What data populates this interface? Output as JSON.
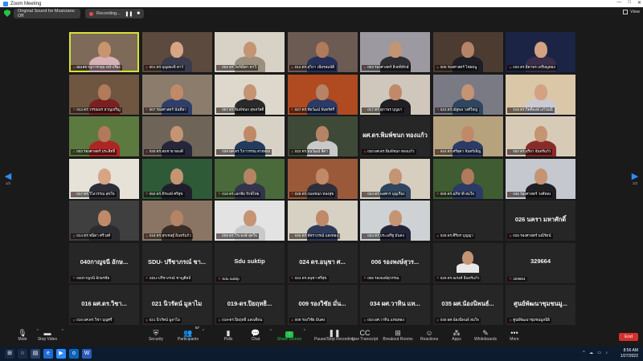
{
  "window": {
    "title": "Zoom Meeting",
    "controls": [
      "—",
      "□",
      "✕"
    ]
  },
  "topbar": {
    "sound_label": "Original Sound for Musicians: Off",
    "recording_label": "Recording...",
    "pause_glyph": "❚❚",
    "stop_glyph": "■",
    "view_label": "View"
  },
  "pager": {
    "left_page": "1/2",
    "right_page": "1/2"
  },
  "participants": [
    {
      "name": "ผมเลขานุการกลุ่ม หน้าเรียง",
      "kind": "video",
      "bg": "#7d6a58",
      "skin": "#c8946e",
      "shirt": "#d8b0b8",
      "active": true
    },
    {
      "name": "001 ดร.บุญผ่องจิ ตาว์",
      "kind": "video",
      "bg": "#5d4a3e",
      "skin": "#d7a586",
      "shirt": "#3b3b4e"
    },
    {
      "name": "002 ดร.ไพร์ณิดา ตาวี",
      "kind": "video",
      "bg": "#d8d1c6",
      "skin": "#c49473",
      "shirt": "#9b8f7d"
    },
    {
      "name": "012 ดร.สุวิภา เพียรสมบัติ",
      "kind": "video",
      "bg": "#6b5b52",
      "skin": "#b07a5b",
      "shirt": "#24305a"
    },
    {
      "name": "003 รองศาสตร์ สิงหพิทักษ์",
      "kind": "video",
      "bg": "#9c9aa0",
      "skin": "#c49473",
      "shirt": "#2d2d32"
    },
    {
      "name": "005 รองศาสตร์ ไชยธนู",
      "kind": "video",
      "bg": "#4c3b31",
      "skin": "#b58365",
      "shirt": "#1e1e26"
    },
    {
      "name": "020 ดร.ธิดาพร เหรียญทอง",
      "kind": "video",
      "bg": "#1b2444",
      "skin": "#d4a182",
      "shirt": "#3a2d4a"
    },
    {
      "name": "013 ดร.วรรณพร หาญเจริญ",
      "kind": "video",
      "bg": "#6e5640",
      "skin": "#b07a5b",
      "shirt": "#7a2020"
    },
    {
      "name": "007 รองศาสตร์ นันทิยา",
      "kind": "video",
      "bg": "#8b7c6c",
      "skin": "#c08a68",
      "shirt": "#2f3f6a"
    },
    {
      "name": "007 ดร.พิมพ์ชนก สุขสวัสดิ์",
      "kind": "video",
      "bg": "#ded8cc",
      "skin": "#c49473",
      "shirt": "#2a2a2a"
    },
    {
      "name": "027 ดร.ชัยวัฒน์ จันทร์ศรี",
      "kind": "video",
      "bg": "#b04a20",
      "skin": "#b58365",
      "shirt": "#2b3a66"
    },
    {
      "name": "017 ดร.สุภาพร บุญมา",
      "kind": "video",
      "bg": "#cfc7bb",
      "skin": "#c08a68",
      "shirt": "#1f1f24"
    },
    {
      "name": "023 ดร.ณัฐพล วงศ์ใหญ่",
      "kind": "video",
      "bg": "#7a7a84",
      "skin": "#c49473",
      "shirt": "#30455e"
    },
    {
      "name": "019 ดร.กิตติพงษ์ แก้วมณี",
      "kind": "video",
      "bg": "#d9c7a8",
      "skin": "#d4a182",
      "shirt": "#c9c9d2"
    },
    {
      "name": "003 รองศาสตร์ ประสิทธิ์",
      "kind": "video",
      "bg": "#5c7a3f",
      "skin": "#b07a5b",
      "shirt": "#b02424"
    },
    {
      "name": "030 ดร.สมชาย ทองดี",
      "kind": "video",
      "bg": "#6e6458",
      "skin": "#c49473",
      "shirt": "#26263a"
    },
    {
      "name": "039 ผศ.ดร.วิภาวรรณ สายทอง",
      "kind": "video",
      "bg": "#d8d2c6",
      "skin": "#c08a68",
      "shirt": "#223b5e"
    },
    {
      "name": "022 ดร.ธนวัฒน์ สีดา",
      "kind": "video",
      "bg": "#3e4a37",
      "skin": "#b58365",
      "shirt": "#c9c9c9"
    },
    {
      "name": "ผศ.ดร.พิมพ์ชนก ทองแก้ว",
      "kind": "name",
      "bg": "#262626",
      "big": "ผศ.ดร.พิมพ์ชนก ทองแก้ว",
      "label": "020 ผศ.ดร.พิมพ์ชนก ทองแก้ว"
    },
    {
      "name": "044 ดร.ศรีสุดา จันทร์เพ็ญ",
      "kind": "video",
      "bg": "#b7a27e",
      "skin": "#c08a68",
      "shirt": "#2b3a66"
    },
    {
      "name": "002 ดร.สุริยา จันทร์แก้ว",
      "kind": "video",
      "bg": "#d7cbb8",
      "skin": "#c49473",
      "shirt": "#8a2b2b"
    },
    {
      "name": "017 ดร.วิไลวรรณ สุขใจ",
      "kind": "video",
      "bg": "#e7e2d8",
      "skin": "#d7a586",
      "shirt": "#2d2d38"
    },
    {
      "name": "050 ดร.ธีรพงษ์ ศรีสุข",
      "kind": "video",
      "bg": "#2f5a38",
      "skin": "#c49473",
      "shirt": "#1f1f2c"
    },
    {
      "name": "018 ดร.เอกชัย รักษ์ไทย",
      "kind": "video",
      "bg": "#4a6a3c",
      "skin": "#b58365",
      "shirt": "#33344a"
    },
    {
      "name": "028 ดร.กมลชนก ทองสุข",
      "kind": "video",
      "bg": "#9a5a3a",
      "skin": "#c08a68",
      "shirt": "#2e2e3a"
    },
    {
      "name": "024 ดร.พงศกร บุญเรือง",
      "kind": "video",
      "bg": "#d6cfc0",
      "skin": "#c49473",
      "shirt": "#30455e"
    },
    {
      "name": "009 ดร.อภิชาติ สมใจ",
      "kind": "video",
      "bg": "#3f5c33",
      "skin": "#b07a5b",
      "shirt": "#2b3a66"
    },
    {
      "name": "045 รองศาสตร์ วงศ์ทอง",
      "kind": "video",
      "bg": "#c5c8ce",
      "skin": "#c49473",
      "shirt": "#1f1f24"
    },
    {
      "name": "014 ดร.ชนิดา ศรีวงศ์",
      "kind": "video",
      "bg": "#3f3f3f",
      "skin": "#c08a68",
      "shirt": "#2b2b30"
    },
    {
      "name": "018 ดร.สุรเชษฐ์ อินทร์แก้ว",
      "kind": "video",
      "bg": "#8a7565",
      "skin": "#b58365",
      "shirt": "#3a2d26"
    },
    {
      "name": "009 ดร.วีระพงษ์ สุดใจ",
      "kind": "video",
      "bg": "#e3e3e3",
      "skin": "#c49473",
      "shirt": "#c9c9c9"
    },
    {
      "name": "040 ดร.พัชราภรณ์ แสงทอง",
      "kind": "video",
      "bg": "#d7d1c4",
      "skin": "#c08a68",
      "shirt": "#2e3a5a"
    },
    {
      "name": "034 ดร.ประเสริฐ มั่นคง",
      "kind": "video",
      "bg": "#cfd2d4",
      "skin": "#c49473",
      "shirt": "#25253a"
    },
    {
      "name": "028 ดร.ศิริพร บุญญา",
      "kind": "name",
      "bg": "#262626",
      "big": "",
      "label": "028 ดร.ศิริพร บุญญา"
    },
    {
      "name": "026 รองศาสตร์ มณีรัตน์",
      "kind": "name",
      "bg": "#262626",
      "big": "026 นครา มหาศักดิ์",
      "label": "026 รองศาสตร์ มณีรัตน์"
    },
    {
      "name": "040กาญจนี อักษ...",
      "kind": "name",
      "bg": "#262626",
      "big": "040กาญจนี อักษ...",
      "label": "040กาญจนี อักษรชัย"
    },
    {
      "name": "SDU-ปรีชาภรณ์ ชา...",
      "kind": "name",
      "bg": "#262626",
      "big": "SDU- ปรีชาภรณ์ ชา...",
      "label": "SDU-ปรีชาภรณ์ ชาญศิลป์"
    },
    {
      "name": "Sdu suktip",
      "kind": "name",
      "bg": "#262626",
      "big": "Sdu suktip",
      "label": "Sdu suktip"
    },
    {
      "name": "024 ดร.อนุชา ศ...",
      "kind": "name",
      "bg": "#262626",
      "big": "024 ดร.อนุชา ศ...",
      "label": "024 ดร.อนุชา ศรีสุข"
    },
    {
      "name": "006 รองพงษ์สุวร...",
      "kind": "name",
      "bg": "#262626",
      "big": "006 รองพงษ์สุวร...",
      "label": "006 รองพงษ์สุวรรณ"
    },
    {
      "name": "029 ดร.ณรงค์ อินทร์แก้ว",
      "kind": "photo",
      "bg": "#262626",
      "label": "029 ดร.ณรงค์ อินทร์แก้ว"
    },
    {
      "name": "329664",
      "kind": "name",
      "bg": "#262626",
      "big": "329664",
      "label": "329664"
    },
    {
      "name": "016 ผศ.ดร.วิชา...",
      "kind": "name",
      "bg": "#262626",
      "big": "016 ผศ.ดร.วิชา...",
      "label": "016 ผศ.ดร.วิชา บุญศรี"
    },
    {
      "name": "021 นิวรัตน์ มูลาไม",
      "kind": "name",
      "bg": "#262626",
      "big": "021 นิวรัตน์ มูลาไม",
      "label": "021 นิวรัตน์ มูลาไม"
    },
    {
      "name": "019-ดร.ปิยะทิพา...",
      "kind": "name",
      "bg": "#262626",
      "big": "019-ดร.ปิยฤทธิ...",
      "label": "019-ดร.ปิยฤทธิ์ แสงเดือน"
    },
    {
      "name": "009 ดร.ไพรัช มั่น...",
      "kind": "name",
      "bg": "#262626",
      "big": "009 รองวิชัย มั่น...",
      "label": "009 รองวิชัย มั่นคง"
    },
    {
      "name": "034 ผศ.ดร.วาทิน แท...",
      "kind": "name",
      "bg": "#262626",
      "big": "034 ผศ.วาทิน แท...",
      "label": "034 ผศ.วาทิน แทนทอง"
    },
    {
      "name": "035 ผศ.ดร.น้องนิพนธ์...",
      "kind": "name",
      "bg": "#262626",
      "big": "035 ผศ.น้องนิพนธ์...",
      "label": "035 ผศ.น้องนิพนธ์ สมใจ"
    },
    {
      "name": "ศูนย์พัฒนาชุมชน...",
      "kind": "name",
      "bg": "#262626",
      "big": "ศูนย์พัฒนาชุมชนมู...",
      "label": "ศูนย์พัฒนาชุมชนมูลนิธิ"
    }
  ],
  "toolbar": {
    "items": [
      {
        "key": "mute",
        "label": "Mute",
        "glyph": "🎙",
        "caret": true
      },
      {
        "key": "video",
        "label": "Stop Video",
        "glyph": "▬",
        "caret": true
      },
      {
        "key": "security",
        "label": "Security",
        "glyph": "⛨",
        "caret": false
      },
      {
        "key": "participants",
        "label": "Participants",
        "glyph": "👥",
        "caret": true,
        "count": "57"
      },
      {
        "key": "polls",
        "label": "Polls",
        "glyph": "▮",
        "caret": false
      },
      {
        "key": "chat",
        "label": "Chat",
        "glyph": "💬",
        "caret": true
      },
      {
        "key": "share",
        "label": "Share Screen",
        "glyph": "↑",
        "caret": true
      },
      {
        "key": "recording",
        "label": "Pause/Stop Recording",
        "glyph": "❚❚",
        "caret": false
      },
      {
        "key": "transcript",
        "label": "Live Transcript",
        "glyph": "CC",
        "caret": false
      },
      {
        "key": "breakout",
        "label": "Breakout Rooms",
        "glyph": "⊞",
        "caret": false
      },
      {
        "key": "reactions",
        "label": "Reactions",
        "glyph": "☺",
        "caret": false
      },
      {
        "key": "apps",
        "label": "Apps",
        "glyph": "⁂",
        "caret": false
      },
      {
        "key": "whiteboards",
        "label": "Whiteboards",
        "glyph": "✎",
        "caret": false
      },
      {
        "key": "more",
        "label": "More",
        "glyph": "•••",
        "caret": false
      }
    ],
    "end_label": "End"
  },
  "taskbar": {
    "apps": [
      {
        "key": "start",
        "glyph": "⊞",
        "color": "#1a2a44"
      },
      {
        "key": "search",
        "glyph": "○",
        "color": "#1a2a44"
      },
      {
        "key": "files",
        "glyph": "▤",
        "color": "#2b3f66"
      },
      {
        "key": "edge",
        "glyph": "e",
        "color": "#1e6bd6"
      },
      {
        "key": "zoom",
        "glyph": "▶",
        "color": "#2d8cff"
      },
      {
        "key": "outlook",
        "glyph": "o",
        "color": "#0a64b8"
      },
      {
        "key": "word",
        "glyph": "W",
        "color": "#2b5bb8"
      }
    ],
    "tray": "^ ☁ ▭ ♪",
    "time": "8:56 AM",
    "date": "1/27/2022"
  },
  "colors": {
    "accent": "#2d8cff",
    "active_speaker": "#d4e23a",
    "share_green": "#23c24b",
    "end_red": "#d3312c",
    "muted_red": "#e24444"
  }
}
